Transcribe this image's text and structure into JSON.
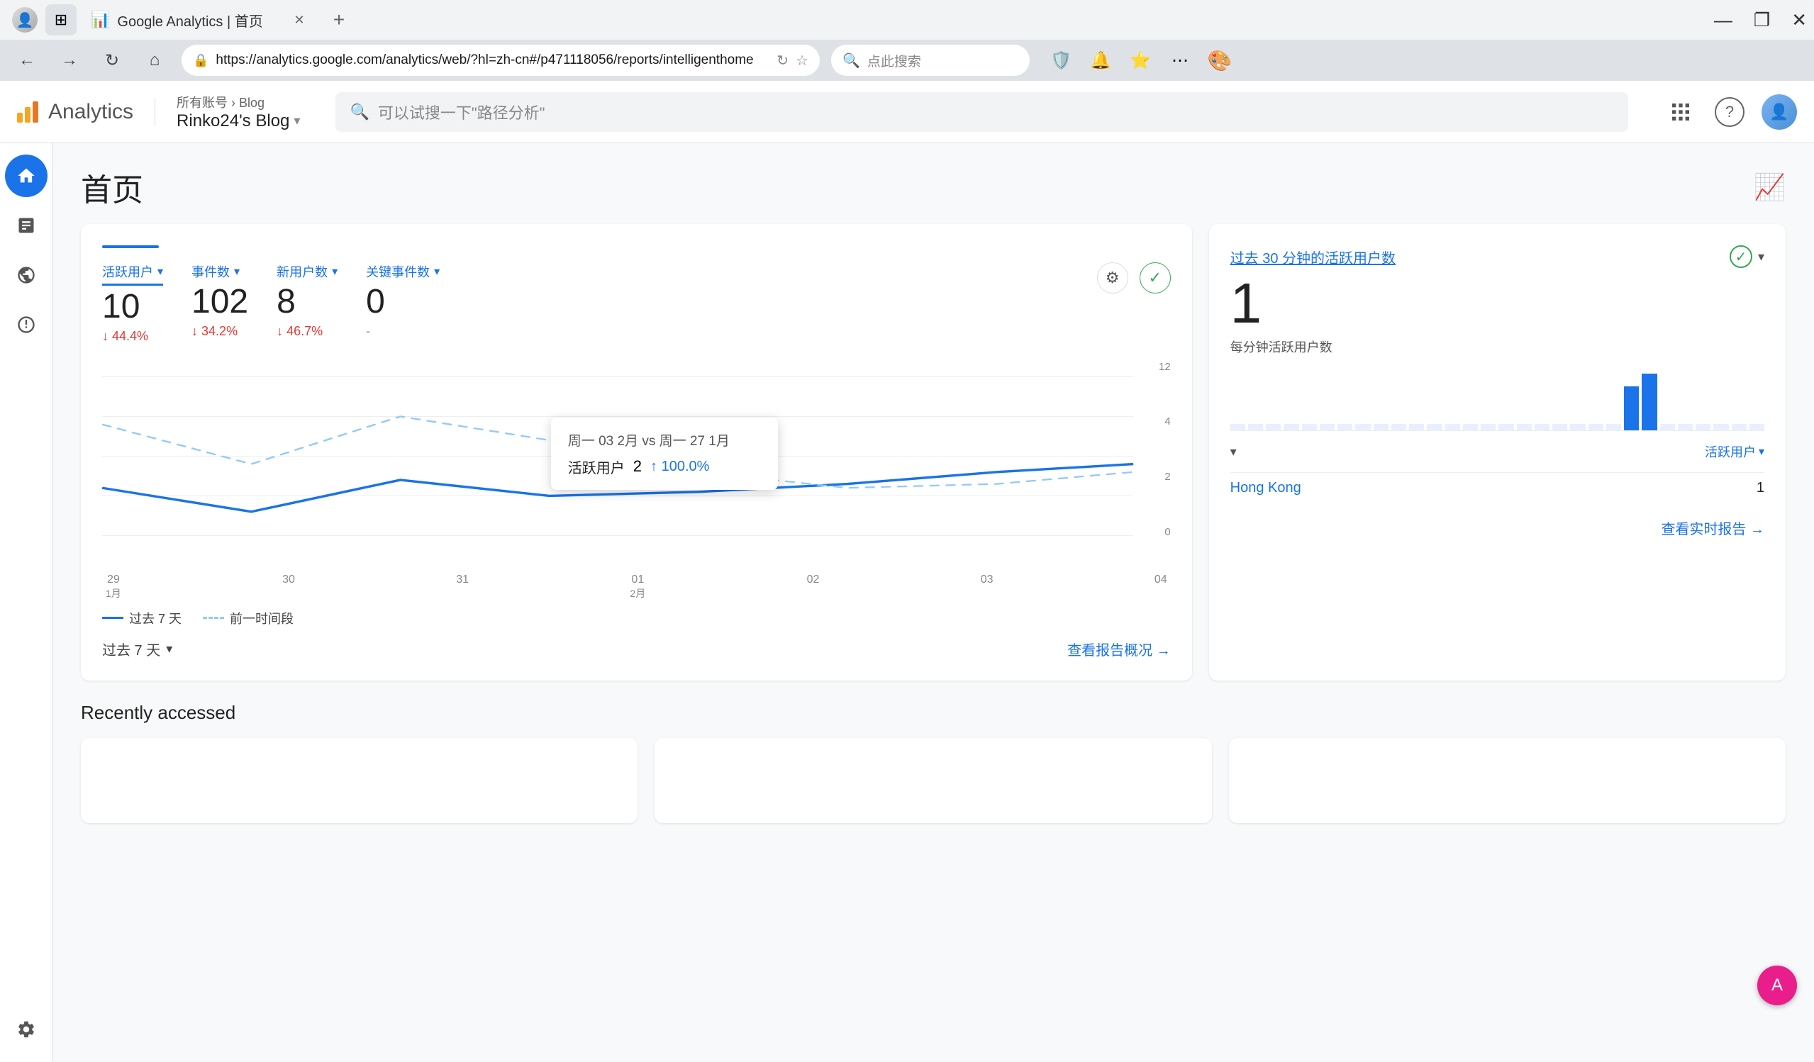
{
  "browser": {
    "tab_title": "Google Analytics | 首页",
    "tab_favicon": "📊",
    "url": "https://analytics.google.com/analytics/web/?hl=zh-cn#/p471118056/reports/intelligenthome",
    "search_placeholder": "点此搜索",
    "new_tab_label": "+",
    "nav": {
      "back": "←",
      "forward": "→",
      "refresh": "↻",
      "home": "⌂"
    },
    "win_controls": {
      "minimize": "—",
      "maximize": "❐",
      "close": "✕"
    }
  },
  "analytics": {
    "logo_text": "Analytics",
    "breadcrumb": "所有账号 › Blog",
    "blog_name": "Rinko24's Blog",
    "dropdown_arrow": "▾",
    "search_placeholder": "可以试搜一下\"路径分析\"",
    "page_title": "首页",
    "metrics": {
      "active_users": {
        "label": "活跃用户",
        "value": "10",
        "change": "↓ 44.4%",
        "change_type": "down",
        "active": true
      },
      "events": {
        "label": "事件数",
        "value": "102",
        "change": "↓ 34.2%",
        "change_type": "down"
      },
      "new_users": {
        "label": "新用户数",
        "value": "8",
        "change": "↓ 46.7%",
        "change_type": "down"
      },
      "key_events": {
        "label": "关键事件数",
        "value": "0",
        "change": "-",
        "change_type": "neutral"
      }
    },
    "chart": {
      "y_max": "12",
      "y_4": "4",
      "y_2": "2",
      "y_0": "0",
      "x_labels": [
        "29",
        "30",
        "31",
        "01",
        "02",
        "03",
        "04"
      ],
      "x_sub_labels": [
        "1月",
        "",
        "",
        "2月",
        "",
        "",
        ""
      ],
      "legend_current": "过去 7 天",
      "legend_previous": "前一时间段"
    },
    "tooltip": {
      "title": "周一 03 2月 vs 周一 27 1月",
      "metric": "活跃用户",
      "value": "2",
      "change": "↑ 100.0%"
    },
    "period_selector": "过去 7 天",
    "view_report_link": "查看报告概况 →",
    "realtime": {
      "label": "过去 30 分钟的活跃用户数",
      "value": "1",
      "sub_label": "每分钟活跃用户数",
      "location_label": "Hong Kong",
      "location_count": "1",
      "metric_selector": "活跃用户",
      "view_realtime_link": "查看实时报告 →"
    },
    "recently_accessed": {
      "title": "Recently accessed"
    }
  }
}
